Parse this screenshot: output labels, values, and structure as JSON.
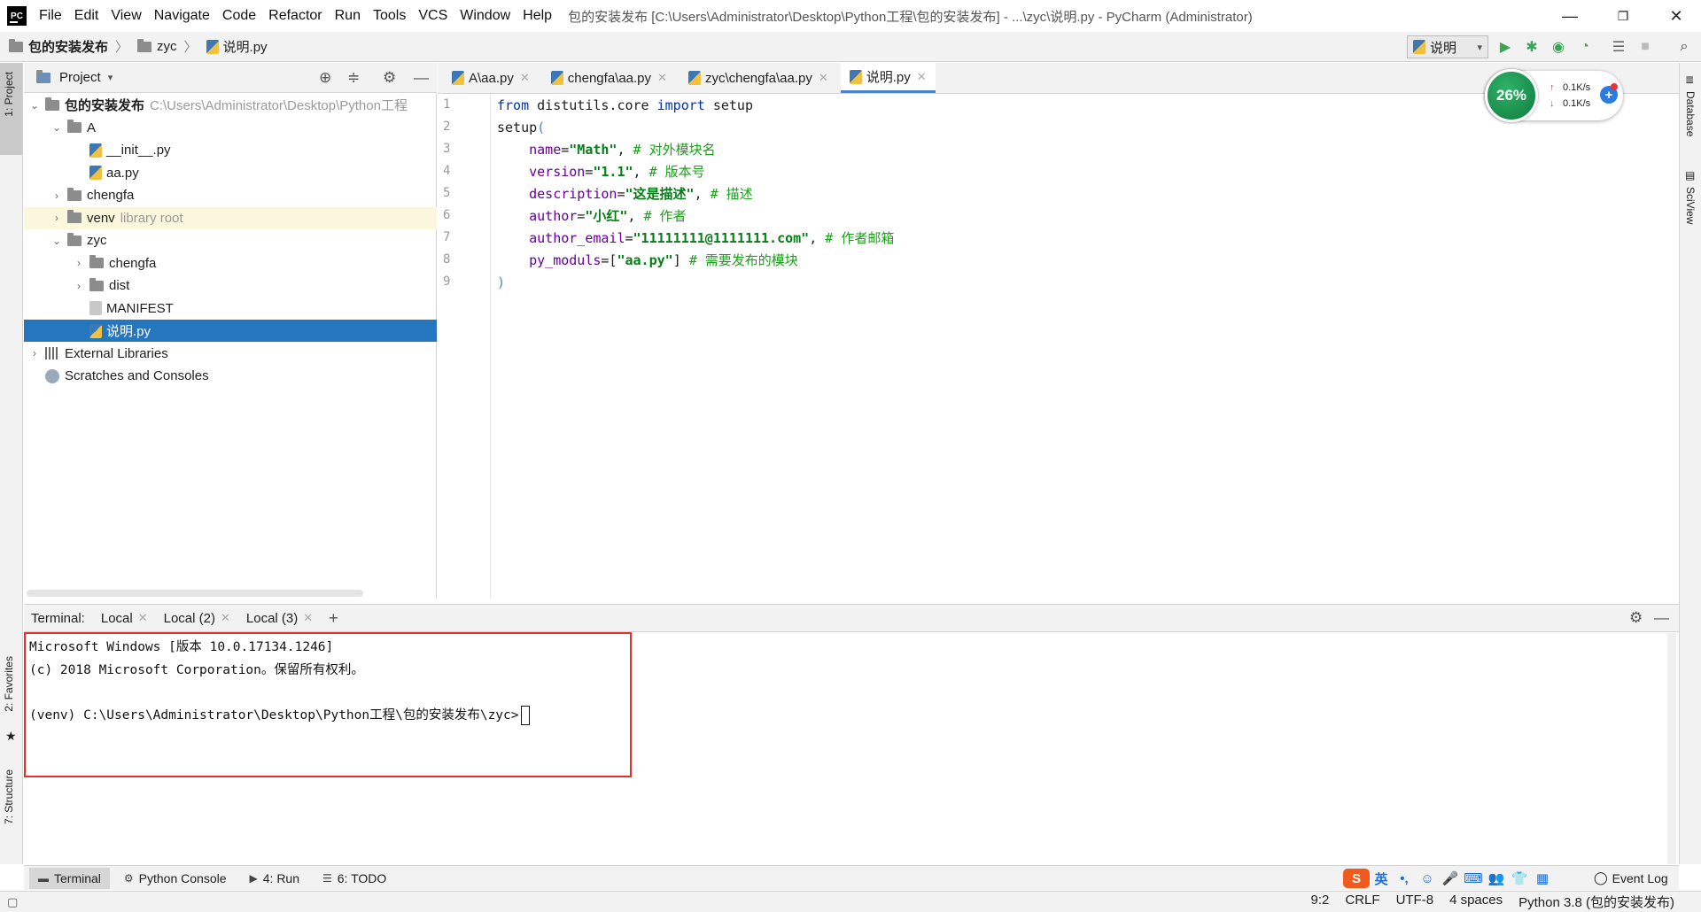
{
  "window": {
    "logo": "PC",
    "title": "包的安装发布 [C:\\Users\\Administrator\\Desktop\\Python工程\\包的安装发布] - ...\\zyc\\说明.py - PyCharm (Administrator)",
    "minimize": "—",
    "restore": "❐",
    "close": "✕"
  },
  "menu": [
    "File",
    "Edit",
    "View",
    "Navigate",
    "Code",
    "Refactor",
    "Run",
    "Tools",
    "VCS",
    "Window",
    "Help"
  ],
  "breadcrumb": [
    "包的安装发布",
    "zyc",
    "说明.py"
  ],
  "run_config": "说明",
  "toolbar_icons": [
    "run-icon",
    "debug-icon",
    "coverage-icon",
    "profile-icon",
    "build-icon",
    "stop-icon",
    "search-icon"
  ],
  "left_stripe": {
    "project": "1: Project",
    "favorites": "2: Favorites",
    "structure": "7: Structure"
  },
  "right_stripe": {
    "database": "Database",
    "sciview": "SciView"
  },
  "project_panel": {
    "title": "Project",
    "tree": [
      {
        "label": "包的安装发布",
        "hint": "C:\\Users\\Administrator\\Desktop\\Python工程",
        "indent": 0,
        "chev": "v",
        "icon": "folder",
        "bold": true
      },
      {
        "label": "A",
        "indent": 1,
        "chev": "v",
        "icon": "folder"
      },
      {
        "label": "__init__.py",
        "indent": 2,
        "chev": "",
        "icon": "py"
      },
      {
        "label": "aa.py",
        "indent": 2,
        "chev": "",
        "icon": "py"
      },
      {
        "label": "chengfa",
        "indent": 1,
        "chev": ">",
        "icon": "folder"
      },
      {
        "label": "venv",
        "hint": "library root",
        "indent": 1,
        "chev": ">",
        "icon": "folder",
        "venv": true
      },
      {
        "label": "zyc",
        "indent": 1,
        "chev": "v",
        "icon": "folder"
      },
      {
        "label": "chengfa",
        "indent": 2,
        "chev": ">",
        "icon": "folder"
      },
      {
        "label": "dist",
        "indent": 2,
        "chev": ">",
        "icon": "folder"
      },
      {
        "label": "MANIFEST",
        "indent": 2,
        "chev": "",
        "icon": "file"
      },
      {
        "label": "说明.py",
        "indent": 2,
        "chev": "",
        "icon": "py",
        "selected": true
      },
      {
        "label": "External Libraries",
        "indent": 0,
        "chev": ">",
        "icon": "lib"
      },
      {
        "label": "Scratches and Consoles",
        "indent": 0,
        "chev": "",
        "icon": "scratch"
      }
    ]
  },
  "editor_tabs": [
    {
      "label": "A\\aa.py",
      "active": false
    },
    {
      "label": "chengfa\\aa.py",
      "active": false
    },
    {
      "label": "zyc\\chengfa\\aa.py",
      "active": false
    },
    {
      "label": "说明.py",
      "active": true
    }
  ],
  "code": {
    "line_numbers": [
      "1",
      "2",
      "3",
      "4",
      "5",
      "6",
      "7",
      "8",
      "9"
    ],
    "current_line": 9,
    "lines": [
      [
        [
          "kw",
          "from"
        ],
        [
          "fn",
          " distutils.core "
        ],
        [
          "kw",
          "import"
        ],
        [
          "fn",
          " setup"
        ]
      ],
      [
        [
          "fn",
          "setup"
        ],
        [
          "paren",
          "("
        ]
      ],
      [
        [
          "fn",
          "    "
        ],
        [
          "param",
          "name"
        ],
        [
          "punc",
          "="
        ],
        [
          "str",
          "\"Math\""
        ],
        [
          "punc",
          ","
        ],
        [
          "cmt",
          " # 对外模块名"
        ]
      ],
      [
        [
          "fn",
          "    "
        ],
        [
          "param",
          "version"
        ],
        [
          "punc",
          "="
        ],
        [
          "str",
          "\"1.1\""
        ],
        [
          "punc",
          ","
        ],
        [
          "cmt",
          " # 版本号"
        ]
      ],
      [
        [
          "fn",
          "    "
        ],
        [
          "param",
          "description"
        ],
        [
          "punc",
          "="
        ],
        [
          "str",
          "\"这是描述\""
        ],
        [
          "punc",
          ","
        ],
        [
          "cmt",
          " # 描述"
        ]
      ],
      [
        [
          "fn",
          "    "
        ],
        [
          "param",
          "author"
        ],
        [
          "punc",
          "="
        ],
        [
          "str",
          "\"小红\""
        ],
        [
          "punc",
          ","
        ],
        [
          "cmt",
          " # 作者"
        ]
      ],
      [
        [
          "fn",
          "    "
        ],
        [
          "param",
          "author_email"
        ],
        [
          "punc",
          "="
        ],
        [
          "str",
          "\"11111111@1111111.com\""
        ],
        [
          "punc",
          ","
        ],
        [
          "cmt",
          " # 作者邮箱"
        ]
      ],
      [
        [
          "fn",
          "    "
        ],
        [
          "param",
          "py_moduls"
        ],
        [
          "punc",
          "=["
        ],
        [
          "str",
          "\"aa.py\""
        ],
        [
          "punc",
          "]"
        ],
        [
          "cmt",
          " # 需要发布的模块"
        ]
      ],
      [
        [
          "paren",
          ")"
        ]
      ]
    ]
  },
  "net_widget": {
    "percent": "26%",
    "up": "0.1K/s",
    "down": "0.1K/s",
    "up_arrow": "↑",
    "down_arrow": "↓",
    "plus": "+"
  },
  "terminal": {
    "label": "Terminal:",
    "tabs": [
      "Local",
      "Local (2)",
      "Local (3)"
    ],
    "add": "+",
    "lines": [
      "Microsoft Windows [版本 10.0.17134.1246]",
      "(c) 2018 Microsoft Corporation。保留所有权利。",
      "",
      "(venv) C:\\Users\\Administrator\\Desktop\\Python工程\\包的安装发布\\zyc>"
    ]
  },
  "tool_windows": [
    {
      "label": "Terminal",
      "icon": "terminal-icon",
      "active": true
    },
    {
      "label": "Python Console",
      "icon": "python-console-icon",
      "active": false
    },
    {
      "label": "4: Run",
      "icon": "run-icon",
      "active": false
    },
    {
      "label": "6: TODO",
      "icon": "todo-icon",
      "active": false
    }
  ],
  "event_log": "Event Log",
  "ime": {
    "logo": "S",
    "lang": "英",
    "items": [
      "•,",
      "☺",
      "🎤",
      "⌨",
      "👥",
      "👕",
      "▦"
    ]
  },
  "status": {
    "position": "9:2",
    "line_sep": "CRLF",
    "encoding": "UTF-8",
    "indent": "4 spaces",
    "interpreter": "Python 3.8 (包的安装发布)"
  }
}
